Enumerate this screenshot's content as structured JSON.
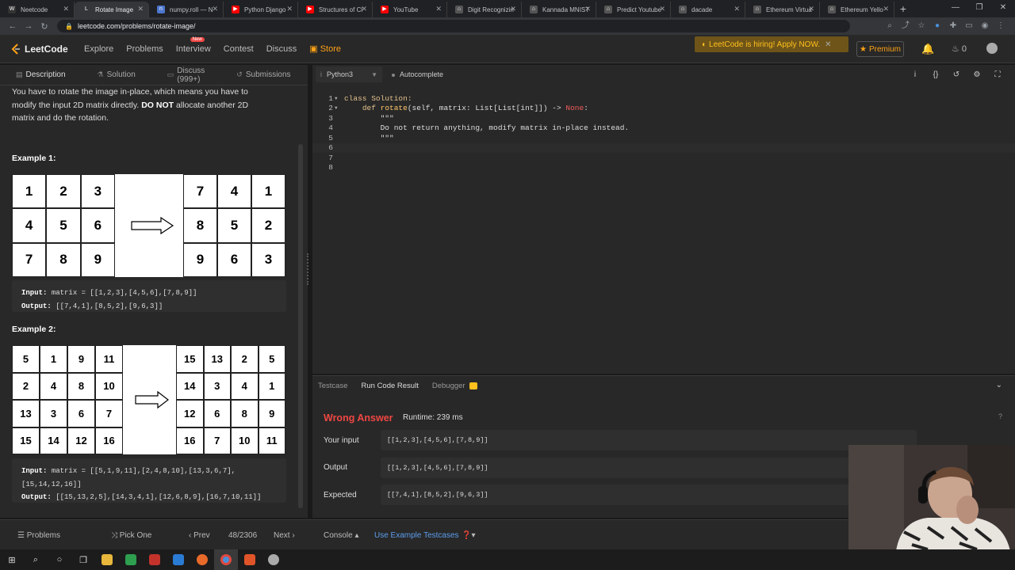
{
  "browser": {
    "tabs": [
      {
        "label": "Neetcode",
        "color": "#333333",
        "glyph": "W"
      },
      {
        "label": "Rotate Image",
        "color": "#35363a",
        "glyph": "L"
      },
      {
        "label": "numpy.roll — N",
        "color": "#4d77cf",
        "glyph": "n"
      },
      {
        "label": "Python Django",
        "color": "#ff0000",
        "glyph": "▶"
      },
      {
        "label": "Structures of Cl",
        "color": "#ff0000",
        "glyph": "▶"
      },
      {
        "label": "YouTube",
        "color": "#ff0000",
        "glyph": "▶"
      },
      {
        "label": "Digit Recognizin",
        "color": "#555555",
        "glyph": "⌂"
      },
      {
        "label": "Kannada MNIST",
        "color": "#555555",
        "glyph": "⌂"
      },
      {
        "label": "Predict Youtube",
        "color": "#555555",
        "glyph": "⌂"
      },
      {
        "label": "dacade",
        "color": "#555555",
        "glyph": "⌂"
      },
      {
        "label": "Ethereum Virtua",
        "color": "#555555",
        "glyph": "⌂"
      },
      {
        "label": "Ethereum Yello",
        "color": "#555555",
        "glyph": "⌂"
      }
    ],
    "url": "leetcode.com/problems/rotate-image/",
    "icons": [
      "search-icon",
      "share-icon",
      "star-icon",
      "extension-icon",
      "puzzle-icon",
      "sidebar-icon",
      "profile-icon",
      "menu-icon"
    ]
  },
  "nav": {
    "logo": "LeetCode",
    "links": [
      "Explore",
      "Problems",
      "Interview",
      "Contest",
      "Discuss"
    ],
    "new_badge": "New",
    "store": "Store",
    "hiring": "LeetCode is hiring! Apply NOW.",
    "premium": "Premium",
    "streak": "0",
    "accent": "#ffa116"
  },
  "left": {
    "tabs": [
      "Description",
      "Solution",
      "Discuss (999+)",
      "Submissions"
    ],
    "desc_line1": "You have to rotate the image in-place, which means you have to",
    "desc_line2": "modify the input 2D matrix directly.",
    "desc_bold": "DO NOT",
    "desc_line2b": "allocate another 2D",
    "desc_line3": "matrix and do the rotation.",
    "example1": {
      "label": "Example 1:",
      "before": [
        [
          "1",
          "2",
          "3"
        ],
        [
          "4",
          "5",
          "6"
        ],
        [
          "7",
          "8",
          "9"
        ]
      ],
      "after": [
        [
          "7",
          "4",
          "1"
        ],
        [
          "8",
          "5",
          "2"
        ],
        [
          "9",
          "6",
          "3"
        ]
      ],
      "input_label": "Input:",
      "input": "matrix = [[1,2,3],[4,5,6],[7,8,9]]",
      "output_label": "Output:",
      "output": "[[7,4,1],[8,5,2],[9,6,3]]"
    },
    "example2": {
      "label": "Example 2:",
      "before": [
        [
          "5",
          "1",
          "9",
          "11"
        ],
        [
          "2",
          "4",
          "8",
          "10"
        ],
        [
          "13",
          "3",
          "6",
          "7"
        ],
        [
          "15",
          "14",
          "12",
          "16"
        ]
      ],
      "after": [
        [
          "15",
          "13",
          "2",
          "5"
        ],
        [
          "14",
          "3",
          "4",
          "1"
        ],
        [
          "12",
          "6",
          "8",
          "9"
        ],
        [
          "16",
          "7",
          "10",
          "11"
        ]
      ],
      "input_label": "Input:",
      "input": "matrix = [[5,1,9,11],[2,4,8,10],[13,3,6,7],",
      "input_cont": "[15,14,12,16]]",
      "output_label": "Output:",
      "output": "[[15,13,2,5],[14,3,4,1],[12,6,8,9],[16,7,10,11]]"
    }
  },
  "editor": {
    "language": "Python3",
    "autocomplete": "Autocomplete",
    "lines": [
      "1",
      "2",
      "3",
      "4",
      "5",
      "6",
      "7",
      "8"
    ],
    "code_class": "class",
    "code_solution": "Solution:",
    "code_def": "def",
    "code_rotate": "rotate",
    "code_sig": "(self, matrix: List[List[int]]) -> ",
    "code_none": "None",
    "code_colon": ":",
    "code_quote": "\"\"\"",
    "code_doc": "Do not return anything, modify matrix in-place instead."
  },
  "result": {
    "tabs": [
      "Testcase",
      "Run Code Result",
      "Debugger"
    ],
    "status": "Wrong Answer",
    "status_color": "#ef4743",
    "runtime": "Runtime: 239 ms",
    "rows": [
      {
        "label": "Your input",
        "value": "[[1,2,3],[4,5,6],[7,8,9]]"
      },
      {
        "label": "Output",
        "value": "[[1,2,3],[4,5,6],[7,8,9]]"
      },
      {
        "label": "Expected",
        "value": "[[7,4,1],[8,5,2],[9,6,3]]"
      }
    ]
  },
  "bottom": {
    "problems": "Problems",
    "pick_one": "Pick One",
    "prev": "Prev",
    "page": "48/2306",
    "next": "Next",
    "console": "Console",
    "use_example": "Use Example Testcases"
  }
}
